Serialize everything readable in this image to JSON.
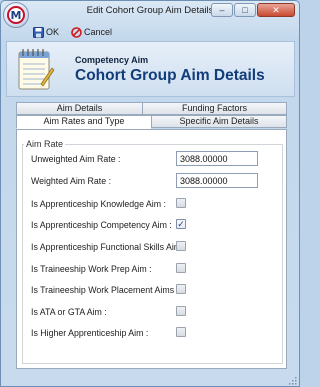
{
  "window": {
    "title": "Edit Cohort Group Aim Details",
    "logo_letter": "M",
    "controls": {
      "minimize": "–",
      "maximize": "□",
      "close": "✕"
    }
  },
  "toolbar": {
    "ok_label": "OK",
    "cancel_label": "Cancel"
  },
  "header": {
    "subtitle": "Competency Aim",
    "title": "Cohort Group Aim Details",
    "icon": "notepad-icon"
  },
  "tabs": {
    "row_back": [
      "Aim Details",
      "Funding Factors"
    ],
    "row_front": [
      "Aim Rates and Type",
      "Specific Aim Details"
    ],
    "active": "Aim Rates and Type"
  },
  "aim_rate": {
    "group_label": "Aim Rate",
    "fields": [
      {
        "label": "Unweighted Aim Rate :",
        "value": "3088.00000"
      },
      {
        "label": "Weighted Aim Rate :",
        "value": "3088.00000"
      }
    ],
    "checkboxes": [
      {
        "label": "Is Apprenticeship Knowledge Aim :",
        "checked": false
      },
      {
        "label": "Is Apprenticeship Competency Aim :",
        "checked": true
      },
      {
        "label": "Is Apprenticeship Functional Skills Aim :",
        "checked": false
      },
      {
        "label": "Is Traineeship Work Prep Aim :",
        "checked": false
      },
      {
        "label": "Is Traineeship Work Placement Aims :",
        "checked": false
      },
      {
        "label": "Is ATA or GTA Aim :",
        "checked": false
      },
      {
        "label": "Is Higher Apprenticeship Aim :",
        "checked": false
      }
    ]
  },
  "colors": {
    "header_title": "#123d7a",
    "checkmark": "#2a3f7a",
    "close_button": "#c94a32"
  }
}
